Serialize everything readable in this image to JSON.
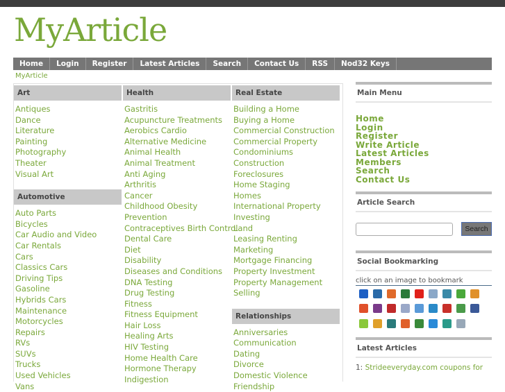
{
  "site_title": "MyArticle",
  "nav": [
    "Home",
    "Login",
    "Register",
    "Latest Articles",
    "Search",
    "Contact Us",
    "RSS",
    "Nod32 Keys"
  ],
  "breadcrumb": "MyArticle",
  "columns": [
    [
      {
        "title": "Art",
        "items": [
          "Antiques",
          "Dance",
          "Literature",
          "Painting",
          "Photography",
          "Theater",
          "Visual Art"
        ]
      },
      {
        "title": "Automotive",
        "items": [
          "Auto Parts",
          "Bicycles",
          "Car Audio and Video",
          "Car Rentals",
          "Cars",
          "Classics Cars",
          "Driving Tips",
          "Gasoline",
          "Hybrids Cars",
          "Maintenance",
          "Motorcycles",
          "Repairs",
          "RVs",
          "SUVs",
          "Trucks",
          "Used Vehicles",
          "Vans"
        ]
      }
    ],
    [
      {
        "title": "Health",
        "items": [
          "Gastritis",
          "Acupuncture Treatments",
          "Aerobics Cardio",
          "Alternative Medicine",
          "Animal Health",
          "Animal Treatment",
          "Anti Aging",
          "Arthritis",
          "Cancer",
          "Childhood Obesity",
          "Prevention",
          "Contraceptives Birth Control",
          "Dental Care",
          "Diet",
          "Disability",
          "Diseases and Conditions",
          "DNA Testing",
          "Drug Testing",
          "Fitness",
          "Fitness Equipment",
          "Hair Loss",
          "Healing Arts",
          "HIV Testing",
          "Home Health Care",
          "Hormone Therapy",
          "Indigestion"
        ]
      }
    ],
    [
      {
        "title": "Real Estate",
        "items": [
          "Building a Home",
          "Buying a Home",
          "Commercial Construction",
          "Commercial Property",
          "Condominiums",
          "Construction",
          "Foreclosures",
          "Home Staging",
          "Homes",
          "International Property",
          "Investing",
          "Land",
          "Leasing Renting",
          "Marketing",
          "Mortgage Financing",
          "Property Investment",
          "Property Management",
          "Selling"
        ]
      },
      {
        "title": "Relationships",
        "items": [
          "Anniversaries",
          "Communication",
          "Dating",
          "Divorce",
          "Domestic Violence",
          "Friendship"
        ]
      }
    ]
  ],
  "sidebar": {
    "main_menu_title": "Main Menu",
    "main_menu": [
      "Home",
      "Login",
      "Register",
      "Write Article",
      "Latest Articles",
      "Members",
      "Search",
      "Contact Us"
    ],
    "search_title": "Article Search",
    "search_value": "",
    "search_button": "Search",
    "social_title": "Social Bookmarking",
    "social_hint": "click on an image to bookmark",
    "social_icon_colors": [
      "#1d5fc4",
      "#2a6aa8",
      "#e06a2a",
      "#2a7a3a",
      "#e0201a",
      "#8aa8c8",
      "#3a8aa8",
      "#4aa83a",
      "#e0902a",
      "#e0502a",
      "#7a3a8a",
      "#c02a2a",
      "#9aa8c8",
      "#5a9ad8",
      "#2a8ac8",
      "#c8302a",
      "#4a9a4a",
      "#3b5998",
      "#8ac83a",
      "#e0a02a",
      "#2a7a7a",
      "#e0602a",
      "#3a8a3a",
      "#2a8ad8",
      "#2a9a8a",
      "#98a8b8"
    ],
    "latest_title": "Latest Articles",
    "latest_num": "1:",
    "latest_item": "Strideeveryday.com coupons for"
  }
}
